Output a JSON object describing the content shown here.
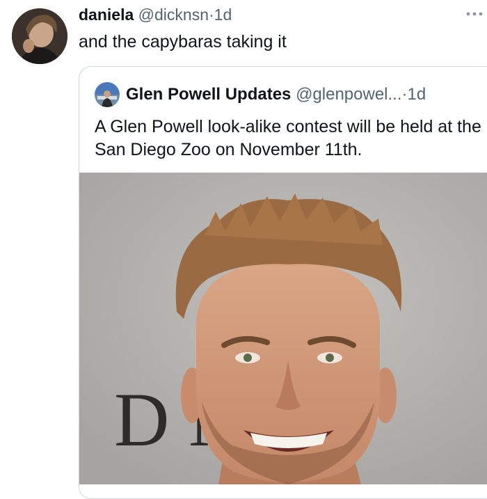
{
  "tweet": {
    "display_name": "daniela",
    "handle": "@dicknsn",
    "separator": "·",
    "time": "1d",
    "text": "and the capybaras taking it",
    "more_icon": "more-horizontal-icon"
  },
  "quote": {
    "display_name": "Glen Powell Updates",
    "handle": "@glenpowel...",
    "separator": "·",
    "time": "1d",
    "text": "A Glen Powell look-alike contest will be held at the San Diego Zoo on November 11th.",
    "backdrop_letters": "D N"
  },
  "colors": {
    "text_primary": "#0f1419",
    "text_secondary": "#536471",
    "border": "#cfd9de",
    "photo_background": "#b3b1ae"
  }
}
